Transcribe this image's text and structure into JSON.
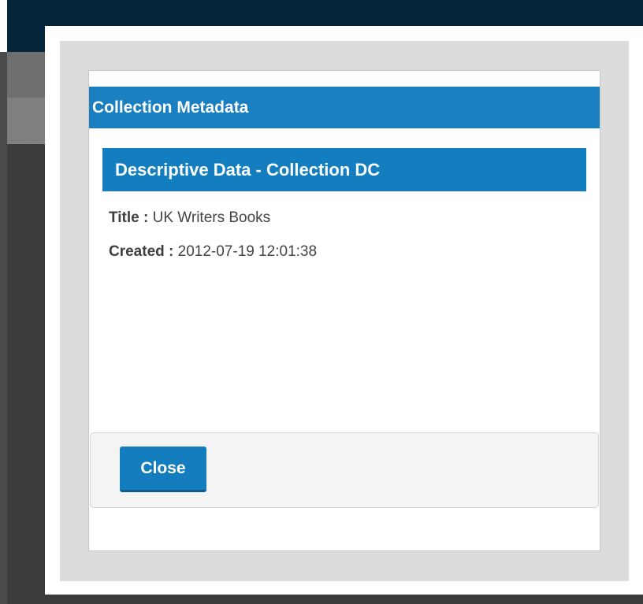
{
  "dialog": {
    "title": "Collection Metadata",
    "section": {
      "title": "Descriptive Data - Collection DC",
      "fields": [
        {
          "label": "Title",
          "separator": " : ",
          "value": "UK Writers Books"
        },
        {
          "label": "Created",
          "separator": " : ",
          "value": "2012-07-19 12:01:38"
        }
      ]
    },
    "footer": {
      "close_label": "Close"
    }
  },
  "colors": {
    "header_blue": "#1a7fc0",
    "button_blue": "#147dbe",
    "app_topbar": "#05263b",
    "modal_frame": "#dcdcdc"
  }
}
